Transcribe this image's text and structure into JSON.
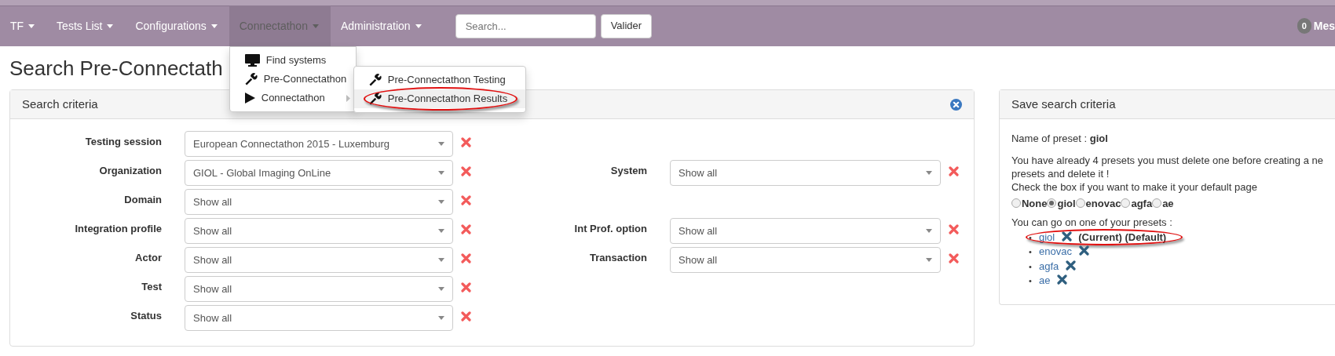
{
  "navbar": {
    "items": [
      {
        "label": "TF",
        "selected": false,
        "open": false
      },
      {
        "label": "Tests List",
        "selected": false,
        "open": false
      },
      {
        "label": "Configurations",
        "selected": false,
        "open": false
      },
      {
        "label": "Connectathon",
        "selected": true,
        "open": true
      },
      {
        "label": "Administration",
        "selected": false,
        "open": false
      }
    ],
    "search": {
      "placeholder": "Search..."
    },
    "search_button": "Valider",
    "messages": {
      "count": "0",
      "label": "Mes"
    }
  },
  "menu": {
    "items": [
      {
        "label": "Find systems",
        "kind": "link"
      },
      {
        "label": "Pre-Connectathon",
        "kind": "link"
      },
      {
        "label": "Connectathon",
        "kind": "submenu"
      }
    ],
    "submenu": [
      {
        "label": "Pre-Connectathon Testing",
        "selected": false,
        "circled": false
      },
      {
        "label": "Pre-Connectathon Results",
        "selected": true,
        "circled": true
      }
    ]
  },
  "page_title": "Search Pre-Connectath",
  "search_panel": {
    "title": "Search criteria",
    "rows": [
      {
        "left": {
          "label": "Testing session",
          "value": "European Connectathon 2015 - Luxemburg"
        }
      },
      {
        "left": {
          "label": "Organization",
          "value": "GIOL - Global Imaging OnLine"
        },
        "right": {
          "label": "System",
          "value": "Show all"
        }
      },
      {
        "left": {
          "label": "Domain",
          "value": "Show all"
        }
      },
      {
        "left": {
          "label": "Integration profile",
          "value": "Show all"
        },
        "right": {
          "label": "Int Prof. option",
          "value": "Show all"
        }
      },
      {
        "left": {
          "label": "Actor",
          "value": "Show all"
        },
        "right": {
          "label": "Transaction",
          "value": "Show all"
        }
      },
      {
        "left": {
          "label": "Test",
          "value": "Show all"
        }
      },
      {
        "left": {
          "label": "Status",
          "value": "Show all"
        }
      }
    ]
  },
  "save_panel": {
    "title": "Save search criteria",
    "name_line": "Name of preset : **giol**",
    "message_lines": [
      "You have already 4 presets you must delete one before creating a ne",
      "presets and delete it !",
      "Check the box if you want to make it your default page"
    ],
    "default_options": [
      {
        "label": "None",
        "selected": false
      },
      {
        "label": "giol",
        "selected": true
      },
      {
        "label": "enovac",
        "selected": false
      },
      {
        "label": "agfa",
        "selected": false
      },
      {
        "label": "ae",
        "selected": false
      }
    ],
    "presets_intro": "You can go on one of your presets :",
    "presets": [
      {
        "bullet": "•",
        "label": "giol",
        "note": "(Current) (Default)",
        "circled": true
      },
      {
        "bullet": "•",
        "label": "enovac",
        "circled": false
      },
      {
        "bullet": "•",
        "label": "agfa",
        "circled": false
      },
      {
        "bullet": "•",
        "label": "ae",
        "circled": false
      }
    ]
  }
}
